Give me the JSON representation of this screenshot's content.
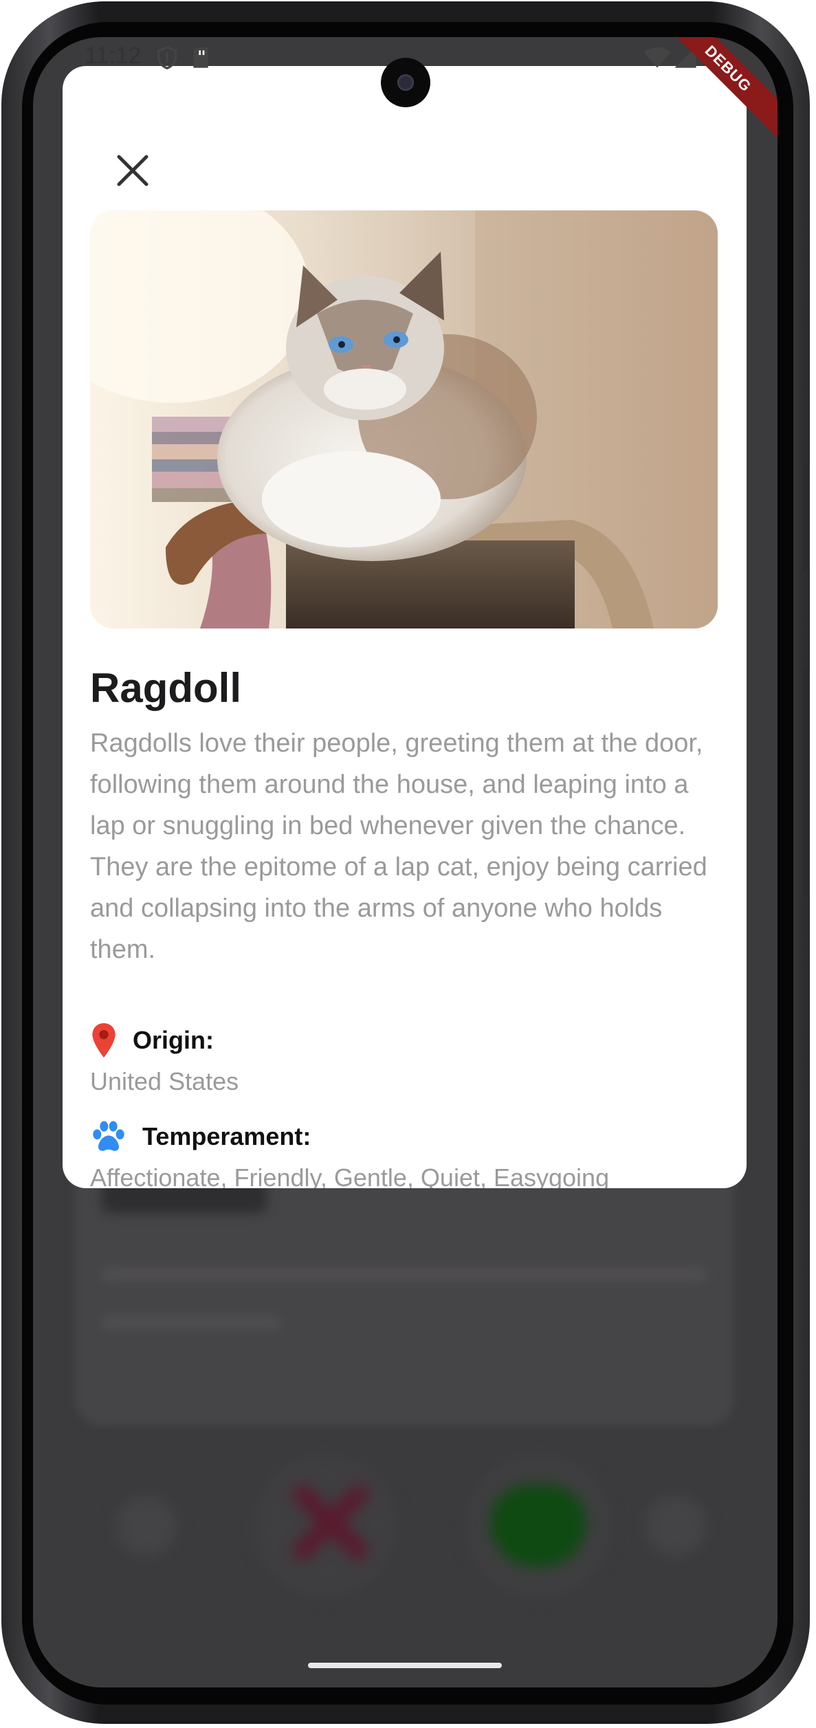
{
  "status_bar": {
    "time": "11:12",
    "debug_banner": "DEBUG"
  },
  "dialog": {
    "close_icon": "close-icon",
    "image_subject": "cat-photo",
    "breed_name": "Ragdoll",
    "description": "Ragdolls love their people, greeting them at the door, following them around the house, and leaping into a lap or snuggling in bed whenever given the chance. They are the epitome of a lap cat, enjoy being carried and collapsing into the arms of anyone who holds them.",
    "origin": {
      "icon": "location-pin-icon",
      "label": "Origin:",
      "value": "United States"
    },
    "temperament": {
      "icon": "paw-icon",
      "label": "Temperament:",
      "value": "Affectionate, Friendly, Gentle, Quiet, Easygoing"
    }
  },
  "colors": {
    "pin": "#ea4335",
    "paw": "#2f8df3",
    "debug": "#8b1a1a",
    "overlay": "#3b3a3c"
  }
}
